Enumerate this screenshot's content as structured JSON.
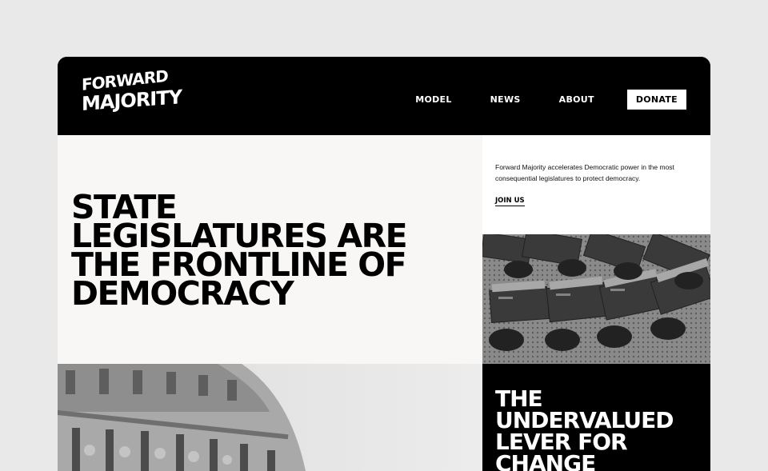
{
  "header": {
    "logo": {
      "line1": "FORWARD",
      "line2": "MAJORITY"
    },
    "nav": [
      {
        "label": "MODEL"
      },
      {
        "label": "NEWS"
      },
      {
        "label": "ABOUT"
      }
    ],
    "donate_label": "DONATE"
  },
  "hero": {
    "headline_lines": [
      "STATE",
      "LEGISLATURES ARE",
      "THE FRONTLINE OF",
      "DEMOCRACY"
    ],
    "blurb": "Forward Majority accelerates Democratic power in the most consequential legislatures to protect democracy.",
    "join_label": "JOIN US"
  },
  "section2": {
    "heading_lines": [
      "THE",
      "UNDERVALUED",
      "LEVER FOR",
      "CHANGE"
    ]
  }
}
